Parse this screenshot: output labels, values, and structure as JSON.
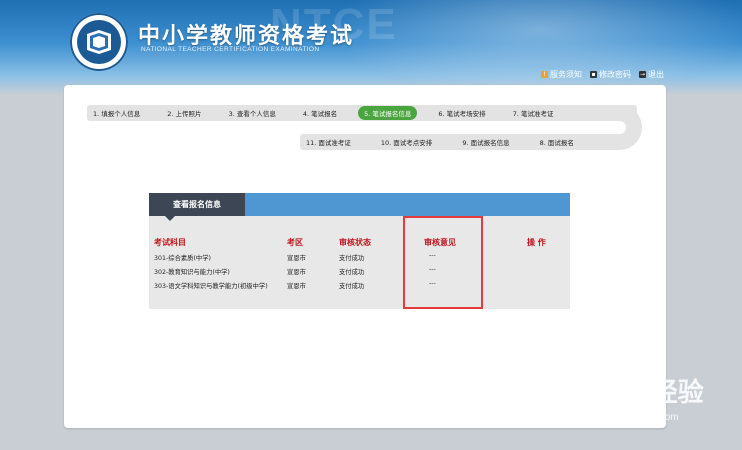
{
  "header": {
    "title": "中小学教师资格考试",
    "subtitle": "NATIONAL TEACHER CERTIFICATION EXAMINATION",
    "watermark": "NTCE",
    "links": [
      {
        "label": "服务须知",
        "icon": "info-icon",
        "color": "#e8a23a"
      },
      {
        "label": "修改密码",
        "icon": "key-icon",
        "color": "#333333"
      },
      {
        "label": "退出",
        "icon": "exit-icon",
        "color": "#333333"
      }
    ]
  },
  "steps": {
    "row1": [
      "1. 填报个人信息",
      "2. 上传照片",
      "3. 查看个人信息",
      "4. 笔试报名",
      "5. 笔试报名信息",
      "6. 笔试考场安排",
      "7. 笔试准考证"
    ],
    "row2": [
      "11. 面试准考证",
      "10. 面试考点安排",
      "9. 面试报名信息",
      "8. 面试报名"
    ],
    "active": "5. 笔试报名信息",
    "active_color": "#4aa53f"
  },
  "card": {
    "tab_label": "查看报名信息",
    "columns": [
      "考试科目",
      "考区",
      "审核状态",
      "审核意见",
      "操 作"
    ],
    "rows": [
      {
        "subject": "301-综合素质(中学)",
        "area": "宣恩市",
        "status": "支付成功",
        "opinion": "---",
        "action": ""
      },
      {
        "subject": "302-教育知识与能力(中学)",
        "area": "宣恩市",
        "status": "支付成功",
        "opinion": "---",
        "action": ""
      },
      {
        "subject": "303-语文学科知识与教学能力(初级中学)",
        "area": "宣恩市",
        "status": "支付成功",
        "opinion": "---",
        "action": ""
      }
    ]
  },
  "watermark_brand": {
    "text": "Bai du 经验",
    "sub": "jingyan.baidu.com"
  }
}
